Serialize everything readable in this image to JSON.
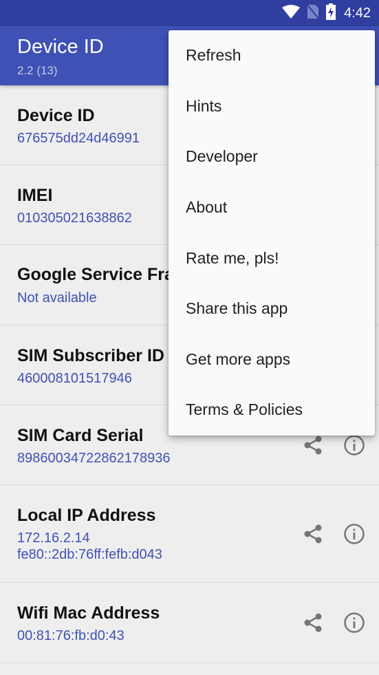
{
  "status_bar": {
    "time": "4:42",
    "icons": [
      "wifi-icon",
      "no-sim-icon",
      "battery-charging-icon"
    ]
  },
  "app_bar": {
    "title": "Device ID",
    "subtitle": "2.2 (13)"
  },
  "list": [
    {
      "title": "Device ID",
      "value": "676575dd24d46991"
    },
    {
      "title": "IMEI",
      "value": "010305021638862"
    },
    {
      "title": "Google Service Framework",
      "value": "Not available"
    },
    {
      "title": "SIM Subscriber ID",
      "value": "460008101517946"
    },
    {
      "title": "SIM Card Serial",
      "value": "89860034722862178936"
    },
    {
      "title": "Local IP Address",
      "value": "172.16.2.14\nfe80::2db:76ff:fefb:d043"
    },
    {
      "title": "Wifi Mac Address",
      "value": "00:81:76:fb:d0:43"
    }
  ],
  "row_actions": {
    "share": "share-icon",
    "info": "info-icon"
  },
  "overflow_menu": {
    "items": [
      "Refresh",
      "Hints",
      "Developer",
      "About",
      "Rate me, pls!",
      "Share this app",
      "Get more apps",
      "Terms & Policies"
    ]
  },
  "colors": {
    "primary_dark": "#303f9f",
    "primary": "#3f51b5",
    "value_text": "#3f51b5",
    "background": "#eeeeee",
    "menu_background": "#fafafa"
  }
}
